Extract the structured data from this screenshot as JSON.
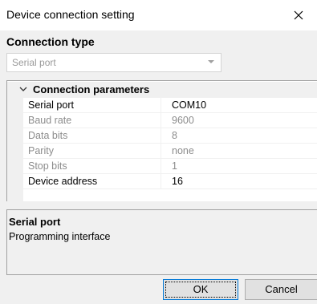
{
  "window": {
    "title": "Device connection setting"
  },
  "connection": {
    "section_label": "Connection type",
    "selected_type": "Serial port"
  },
  "properties": {
    "category": "Connection parameters",
    "rows": [
      {
        "name": "Serial port",
        "value": "COM10",
        "enabled": true
      },
      {
        "name": "Baud rate",
        "value": "9600",
        "enabled": false
      },
      {
        "name": "Data bits",
        "value": "8",
        "enabled": false
      },
      {
        "name": "Parity",
        "value": "none",
        "enabled": false
      },
      {
        "name": "Stop bits",
        "value": "1",
        "enabled": false
      },
      {
        "name": "Device address",
        "value": "16",
        "enabled": true
      }
    ]
  },
  "description": {
    "title": "Serial port",
    "text": "Programming interface"
  },
  "buttons": {
    "ok": "OK",
    "cancel": "Cancel"
  },
  "icons": {
    "close": "close-icon",
    "dropdown": "chevron-down-icon",
    "collapse": "chevron-down-icon"
  }
}
